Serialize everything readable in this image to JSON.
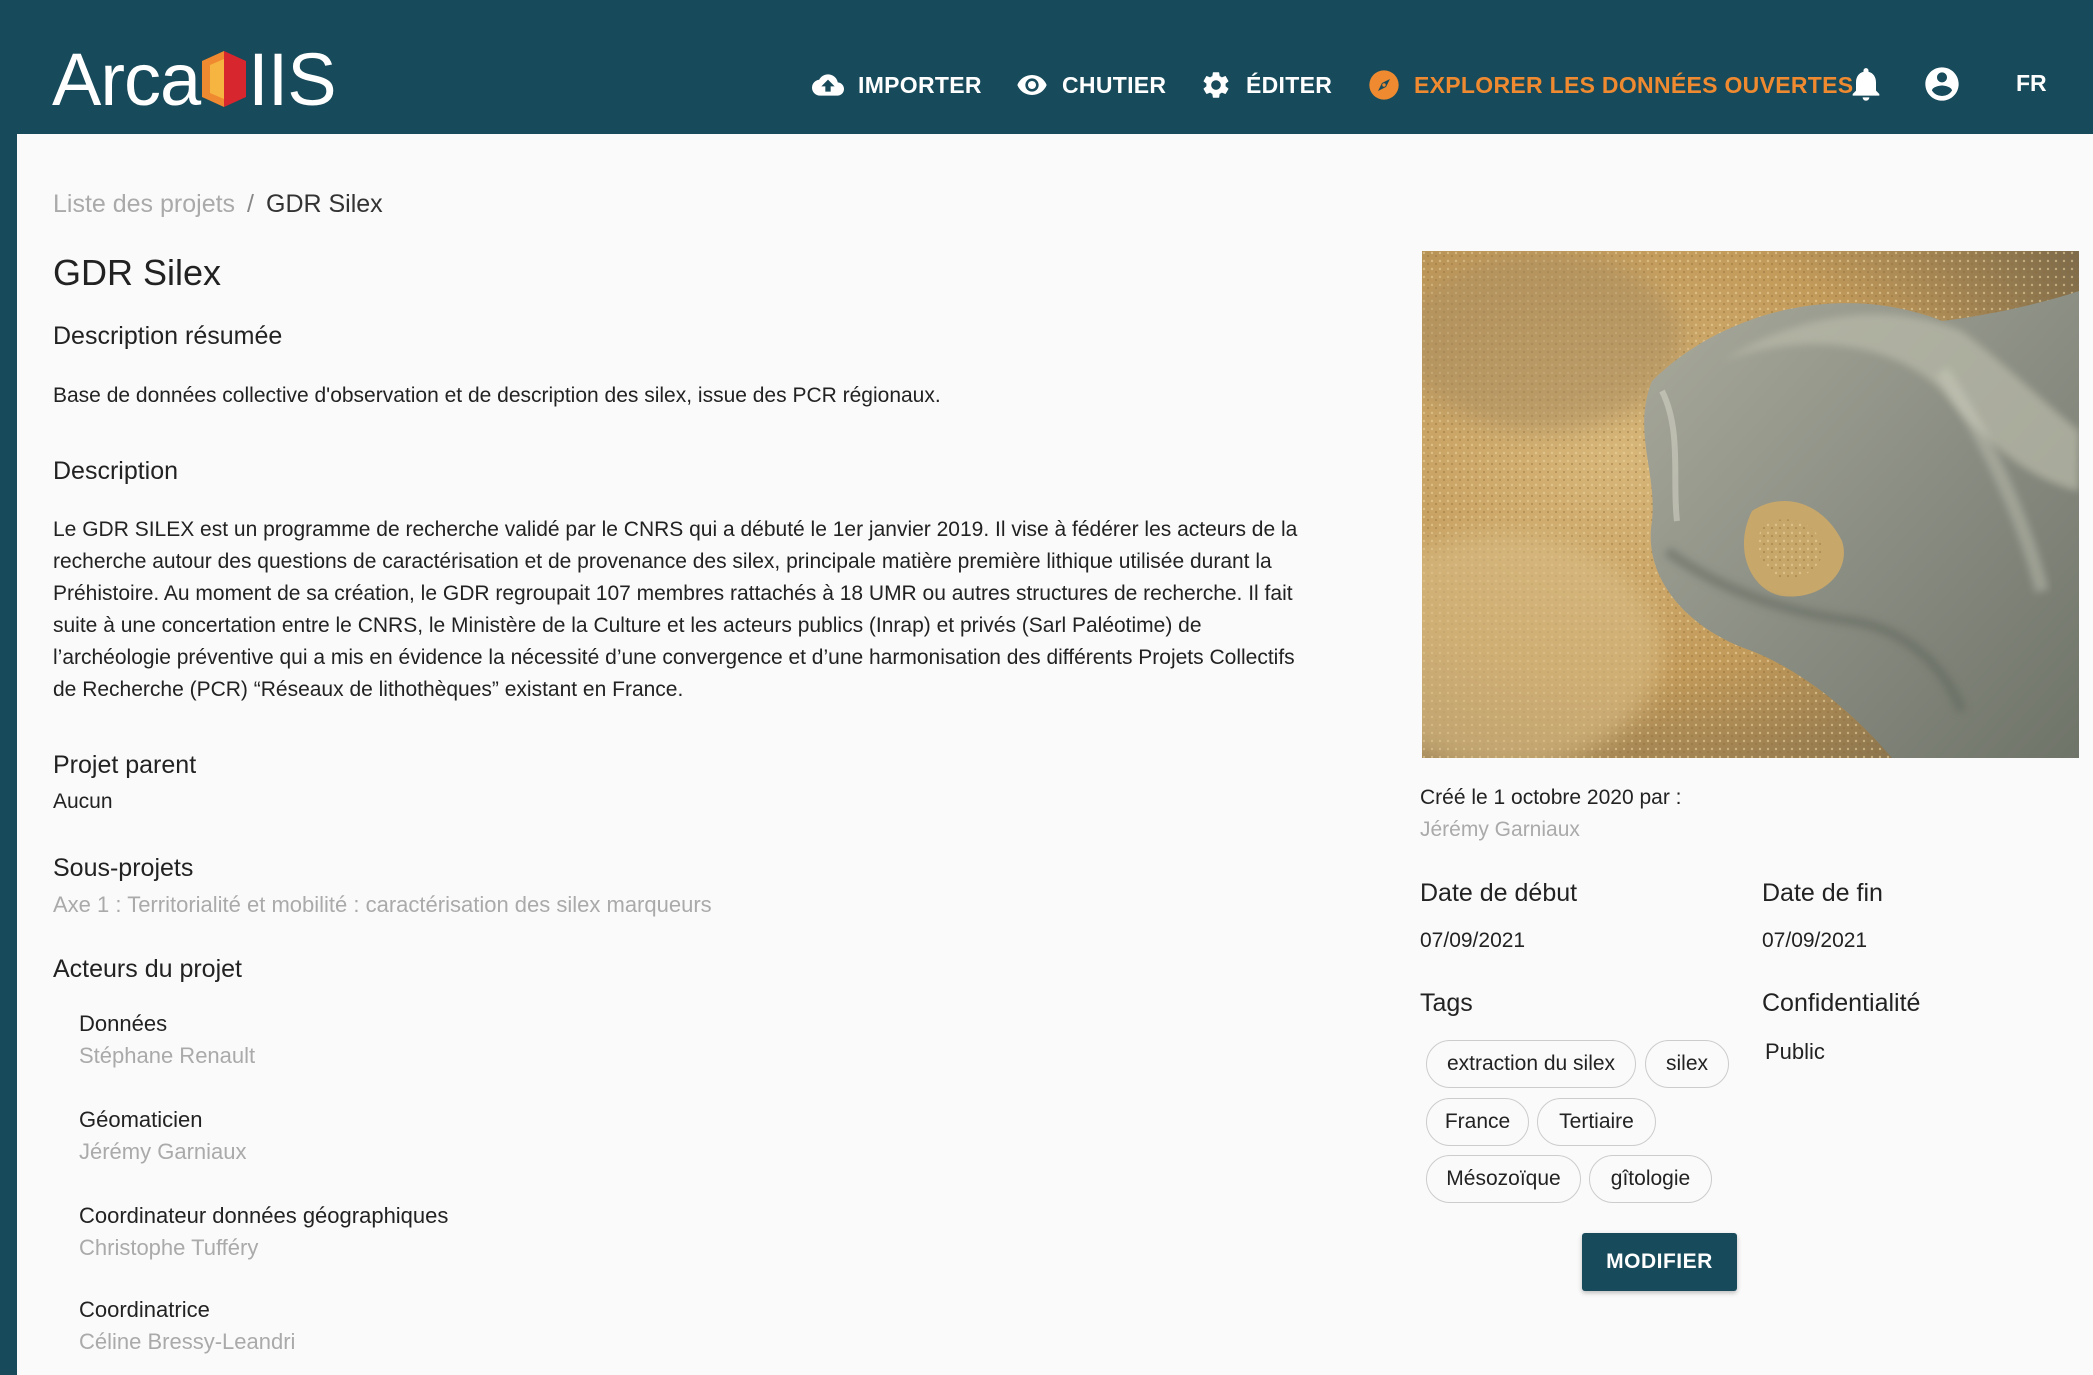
{
  "header": {
    "logo_text_left": "Arca",
    "logo_text_right": "IIS",
    "nav": {
      "import": "IMPORTER",
      "cart": "CHUTIER",
      "edit": "ÉDITER",
      "explore": "EXPLORER LES DONNÉES OUVERTES"
    },
    "lang": "FR",
    "icons": {
      "import": "cloud-upload-icon",
      "cart": "eye-icon",
      "edit": "gear-icon",
      "explore": "compass-icon",
      "notifications": "bell-icon",
      "account": "account-circle-icon"
    }
  },
  "breadcrumb": {
    "parent": "Liste des projets",
    "separator": "/",
    "current": "GDR Silex"
  },
  "project": {
    "title": "GDR Silex",
    "summary_heading": "Description résumée",
    "summary": "Base de données collective d'observation et de description des silex, issue des PCR régionaux.",
    "description_heading": "Description",
    "description_lines": [
      "Le GDR SILEX est un programme de recherche validé par le CNRS qui a débuté le 1er janvier 2019. Il vise à fédérer les acteurs de la",
      "recherche autour des questions de caractérisation et de provenance des silex, principale matière première lithique utilisée durant la",
      "Préhistoire. Au moment de sa création, le GDR regroupait 107 membres rattachés à 18 UMR ou autres structures de recherche. Il fait",
      "suite à une concertation entre le CNRS, le Ministère de la Culture et les acteurs publics (Inrap) et privés (Sarl Paléotime) de",
      "l’archéologie préventive qui a mis en évidence la nécessité d’une convergence et d’une harmonisation des différents Projets Collectifs",
      "de Recherche (PCR) “Réseaux de lithothèques” existant en France."
    ],
    "parent_heading": "Projet parent",
    "parent_value": "Aucun",
    "subprojects_heading": "Sous-projets",
    "subprojects": [
      "Axe 1 : Territorialité et mobilité : caractérisation des silex marqueurs"
    ],
    "actors_heading": "Acteurs du projet",
    "actors": [
      {
        "role": "Données",
        "name": "Stéphane Renault"
      },
      {
        "role": "Géomaticien",
        "name": "Jérémy Garniaux"
      },
      {
        "role": "Coordinateur données géographiques",
        "name": "Christophe Tufféry"
      },
      {
        "role": "Coordinatrice",
        "name": "Céline Bressy-Leandri"
      }
    ]
  },
  "sidebar": {
    "created_label": "Créé le 1 octobre 2020 par :",
    "created_by": "Jérémy Garniaux",
    "start_heading": "Date de début",
    "start_value": "07/09/2021",
    "end_heading": "Date de fin",
    "end_value": "07/09/2021",
    "tags_heading": "Tags",
    "tags": [
      "extraction du silex",
      "silex",
      "France",
      "Tertiaire",
      "Mésozoïque",
      "gîtologie"
    ],
    "confidentiality_heading": "Confidentialité",
    "confidentiality_value": "Public",
    "modify_button": "MODIFIER"
  },
  "colors": {
    "header_bg": "#174a5a",
    "accent": "#f08a30",
    "page_bg": "#fafafa",
    "muted_text": "#aaaaaa"
  }
}
